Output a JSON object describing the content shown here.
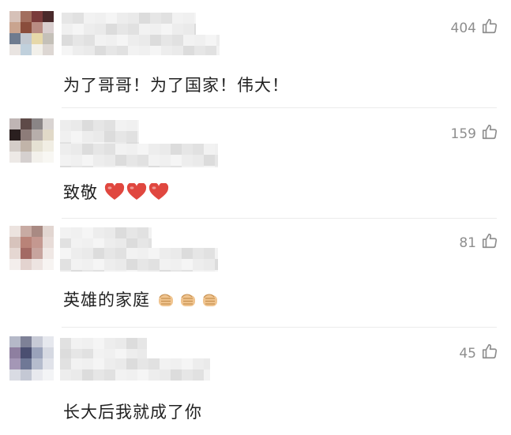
{
  "comments": [
    {
      "text": "为了哥哥！为了国家！伟大！",
      "likes": "404",
      "avatar_colors": [
        "#d6c1b8",
        "#a26e5e",
        "#7a3b3b",
        "#4a2a2b",
        "#c9a48f",
        "#8a4d3c",
        "#b98c83",
        "#d9cfcf",
        "#6e7b8f",
        "#c2c8d0",
        "#e6d8a9",
        "#c4c0b8",
        "#e9e4e1",
        "#c0d0dc",
        "#f2f0ea",
        "#ddd7d3"
      ],
      "decor": []
    },
    {
      "text": "致敬",
      "likes": "159",
      "avatar_colors": [
        "#bfb5b4",
        "#5e4a48",
        "#8a8586",
        "#d9d4d2",
        "#2a1f1f",
        "#8d7c79",
        "#b7aeab",
        "#e1d9c8",
        "#d4cdc9",
        "#c1b4a9",
        "#e5e1d3",
        "#f1eee4",
        "#ede9e6",
        "#d5d0cf",
        "#f3f1ec",
        "#f8f7f3"
      ],
      "decor": [
        "heart-emoji",
        "heart-emoji",
        "heart-emoji"
      ]
    },
    {
      "text": "英雄的家庭",
      "likes": "81",
      "avatar_colors": [
        "#ece3df",
        "#c8aba3",
        "#a98a83",
        "#e2d6d1",
        "#d7c3bc",
        "#b98378",
        "#c49890",
        "#e8dcd8",
        "#e5d7d2",
        "#a36a64",
        "#c7a49e",
        "#f0e8e5",
        "#f3eeec",
        "#e3d3cf",
        "#ede4e1",
        "#f7f4f2"
      ],
      "decor": [
        "fist-emoji",
        "fist-emoji",
        "fist-emoji"
      ]
    },
    {
      "text": "长大后我就成了你",
      "likes": "45",
      "avatar_colors": [
        "#b5b9c8",
        "#7e8197",
        "#c7cad6",
        "#e6e8ee",
        "#8e7fa0",
        "#4b4f71",
        "#9aa2ba",
        "#d6d9e2",
        "#a497b6",
        "#6f7896",
        "#b5bccd",
        "#e1e3ea",
        "#d9dbe3",
        "#c4c8d4",
        "#e8e9ee",
        "#f3f4f6"
      ],
      "decor": []
    }
  ],
  "colors": {
    "text": "#222222",
    "meta": "#8e8e8e",
    "heart": "#e0473f",
    "fist": "#f0c48f"
  }
}
